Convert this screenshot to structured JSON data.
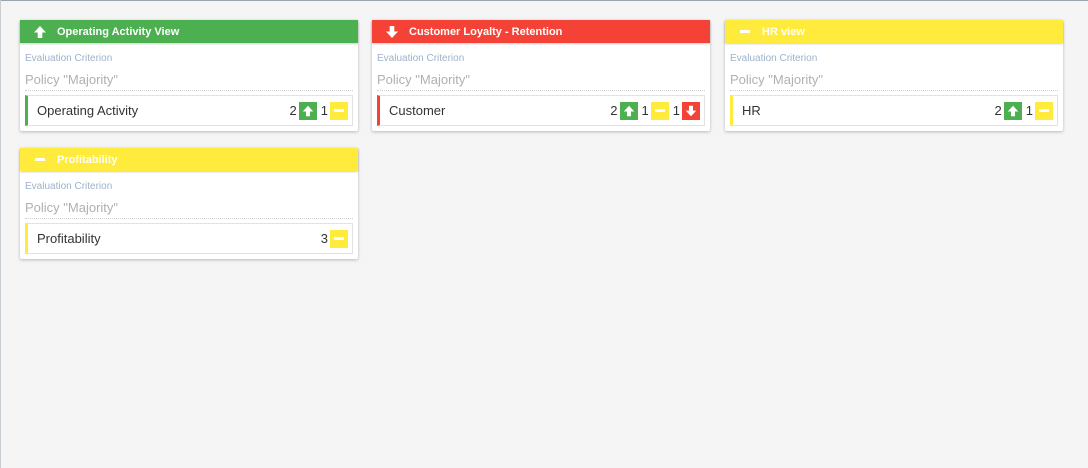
{
  "colors": {
    "green": "#4caf50",
    "red": "#f44336",
    "yellow": "#ffeb3b",
    "background": "#f5f5f5"
  },
  "cards": [
    {
      "title": "Operating Activity View",
      "status": "up",
      "criterion_label": "Evaluation Criterion",
      "policy": "Policy \"Majority\"",
      "row_name": "Operating Activity",
      "counts": [
        {
          "value": "2",
          "status": "up"
        },
        {
          "value": "1",
          "status": "neutral"
        }
      ]
    },
    {
      "title": "Customer Loyalty - Retention",
      "status": "down",
      "criterion_label": "Evaluation Criterion",
      "policy": "Policy \"Majority\"",
      "row_name": "Customer",
      "counts": [
        {
          "value": "2",
          "status": "up"
        },
        {
          "value": "1",
          "status": "neutral"
        },
        {
          "value": "1",
          "status": "down"
        }
      ]
    },
    {
      "title": "HR view",
      "status": "neutral",
      "criterion_label": "Evaluation Criterion",
      "policy": "Policy \"Majority\"",
      "row_name": "HR",
      "counts": [
        {
          "value": "2",
          "status": "up"
        },
        {
          "value": "1",
          "status": "neutral"
        }
      ]
    },
    {
      "title": "Profitability",
      "status": "neutral",
      "criterion_label": "Evaluation Criterion",
      "policy": "Policy \"Majority\"",
      "row_name": "Profitability",
      "counts": [
        {
          "value": "3",
          "status": "neutral"
        }
      ]
    }
  ]
}
